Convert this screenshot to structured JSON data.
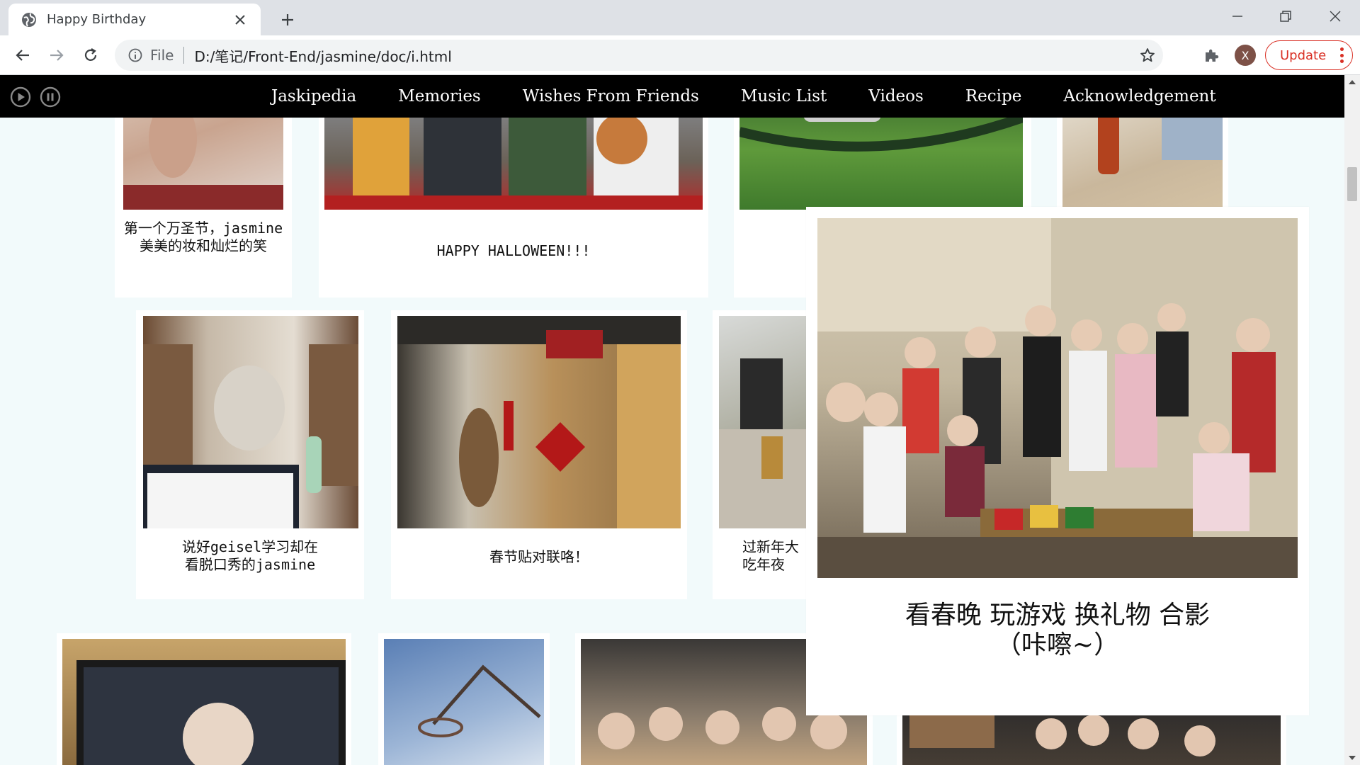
{
  "browser": {
    "tab_title": "Happy Birthday",
    "url_scheme": "File",
    "url": "D:/笔记/Front-End/jasmine/doc/i.html",
    "profile_initial": "X",
    "update_label": "Update"
  },
  "site": {
    "nav": [
      "Jaskipedia",
      "Memories",
      "Wishes From Friends",
      "Music List",
      "Videos",
      "Recipe",
      "Acknowledgement"
    ]
  },
  "gallery": {
    "row1": [
      {
        "caption": "第一个万圣节，jasmine\n美美的妆和灿烂的笑"
      },
      {
        "caption": "HAPPY HALLOWEEN!!!"
      },
      {
        "caption": ""
      },
      {
        "caption": ""
      }
    ],
    "row2": [
      {
        "caption": "说好geisel学习却在\n看脱口秀的jasmine"
      },
      {
        "caption": "春节贴对联咯！"
      },
      {
        "caption": "过新年大\n吃年夜"
      }
    ]
  },
  "popup": {
    "caption": "看春晚 玩游戏 换礼物 合影\n（咔嚓~）"
  }
}
